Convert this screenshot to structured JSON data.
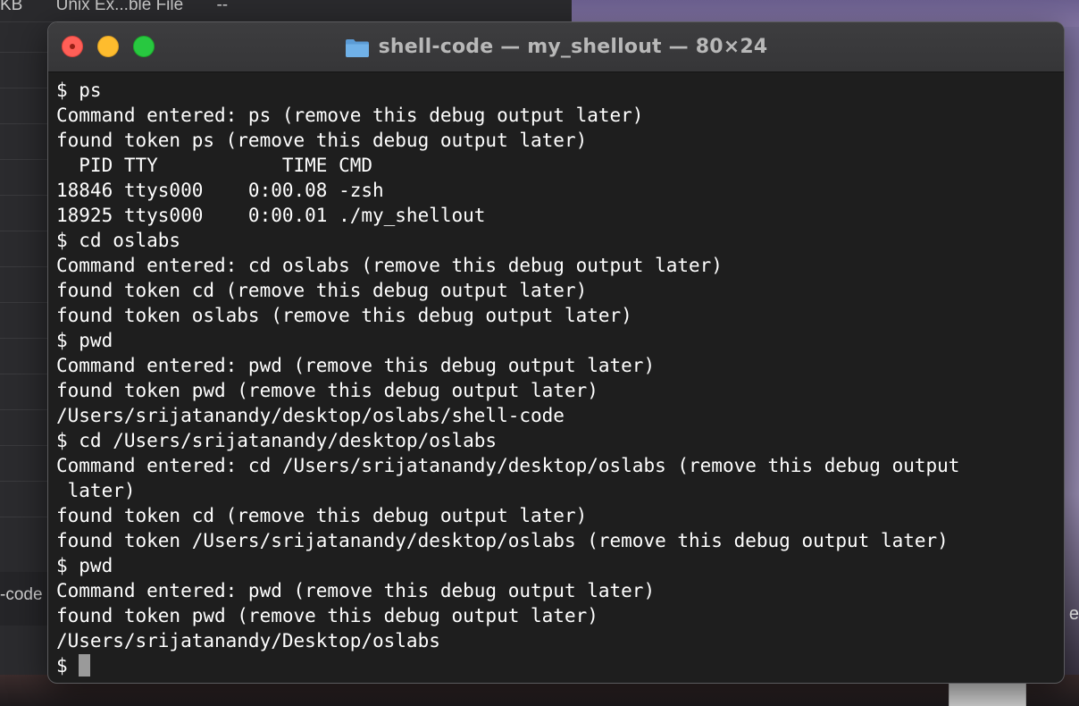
{
  "background": {
    "finder_toprow": [
      "KB",
      "Unix Ex...ble File",
      "--"
    ],
    "sidebar_label": "-code",
    "right_edge_glyph": "e"
  },
  "terminal": {
    "title": "shell-code — my_shellout — 80×24",
    "folder_icon": "folder-icon",
    "prompt_symbol": "$",
    "colors": {
      "background": "#1e1e1e",
      "foreground": "#ffffff",
      "close": "#ff5f57",
      "minimize": "#febc2e",
      "maximize": "#28c840"
    },
    "lines": [
      "$ ps",
      "Command entered: ps (remove this debug output later)",
      "found token ps (remove this debug output later)",
      "  PID TTY           TIME CMD",
      "18846 ttys000    0:00.08 -zsh",
      "18925 ttys000    0:00.01 ./my_shellout",
      "$ cd oslabs",
      "Command entered: cd oslabs (remove this debug output later)",
      "found token cd (remove this debug output later)",
      "found token oslabs (remove this debug output later)",
      "$ pwd",
      "Command entered: pwd (remove this debug output later)",
      "found token pwd (remove this debug output later)",
      "/Users/srijatanandy/desktop/oslabs/shell-code",
      "$ cd /Users/srijatanandy/desktop/oslabs",
      "Command entered: cd /Users/srijatanandy/desktop/oslabs (remove this debug output",
      " later)",
      "found token cd (remove this debug output later)",
      "found token /Users/srijatanandy/desktop/oslabs (remove this debug output later)",
      "$ pwd",
      "Command entered: pwd (remove this debug output later)",
      "found token pwd (remove this debug output later)",
      "/Users/srijatanandy/Desktop/oslabs"
    ],
    "current_prompt": "$ "
  }
}
